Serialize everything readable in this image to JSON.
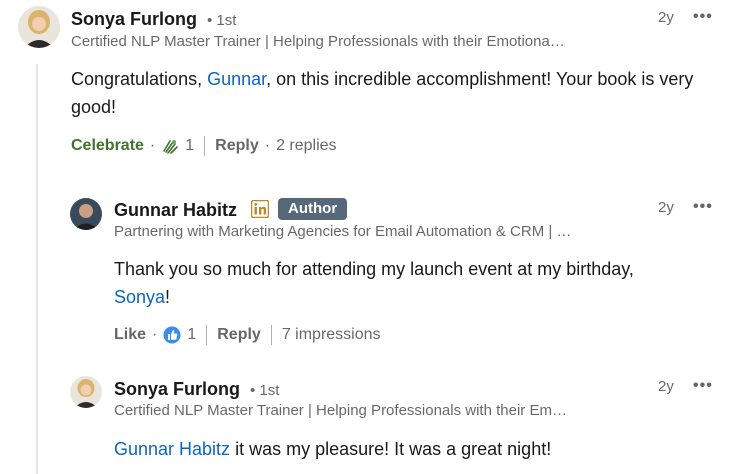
{
  "comment1": {
    "name": "Sonya Furlong",
    "degree": "• 1st",
    "headline": "Certified NLP Master Trainer | Helping Professionals with their Emotiona…",
    "time": "2y",
    "more": "•••",
    "text_pre": "Congratulations, ",
    "mention": "Gunnar",
    "text_post": ", on this incredible accomplishment! Your book is very good!",
    "reaction_label": "Celebrate",
    "reaction_count": "1",
    "reply_label": "Reply",
    "replies": "2 replies"
  },
  "reply1": {
    "name": "Gunnar Habitz",
    "author_badge": "Author",
    "headline": "Partnering with Marketing Agencies for Email Automation & CRM | …",
    "time": "2y",
    "more": "•••",
    "text_pre": "Thank you so much for attending my launch event at my birthday, ",
    "mention": "Sonya",
    "text_post": "!",
    "reaction_label": "Like",
    "reaction_count": "1",
    "reply_label": "Reply",
    "impressions": "7 impressions"
  },
  "reply2": {
    "name": "Sonya Furlong",
    "degree": "• 1st",
    "headline": "Certified NLP Master Trainer | Helping Professionals with their Em…",
    "time": "2y",
    "more": "•••",
    "mention": "Gunnar Habitz",
    "text_post": " it was my pleasure! It was a great night!"
  },
  "separator_dot": "·",
  "colors": {
    "mention": "#0a66c2",
    "celebrate": "#44712e",
    "author_badge": "#56687a",
    "linkedin_badge": "#b58a2a"
  }
}
